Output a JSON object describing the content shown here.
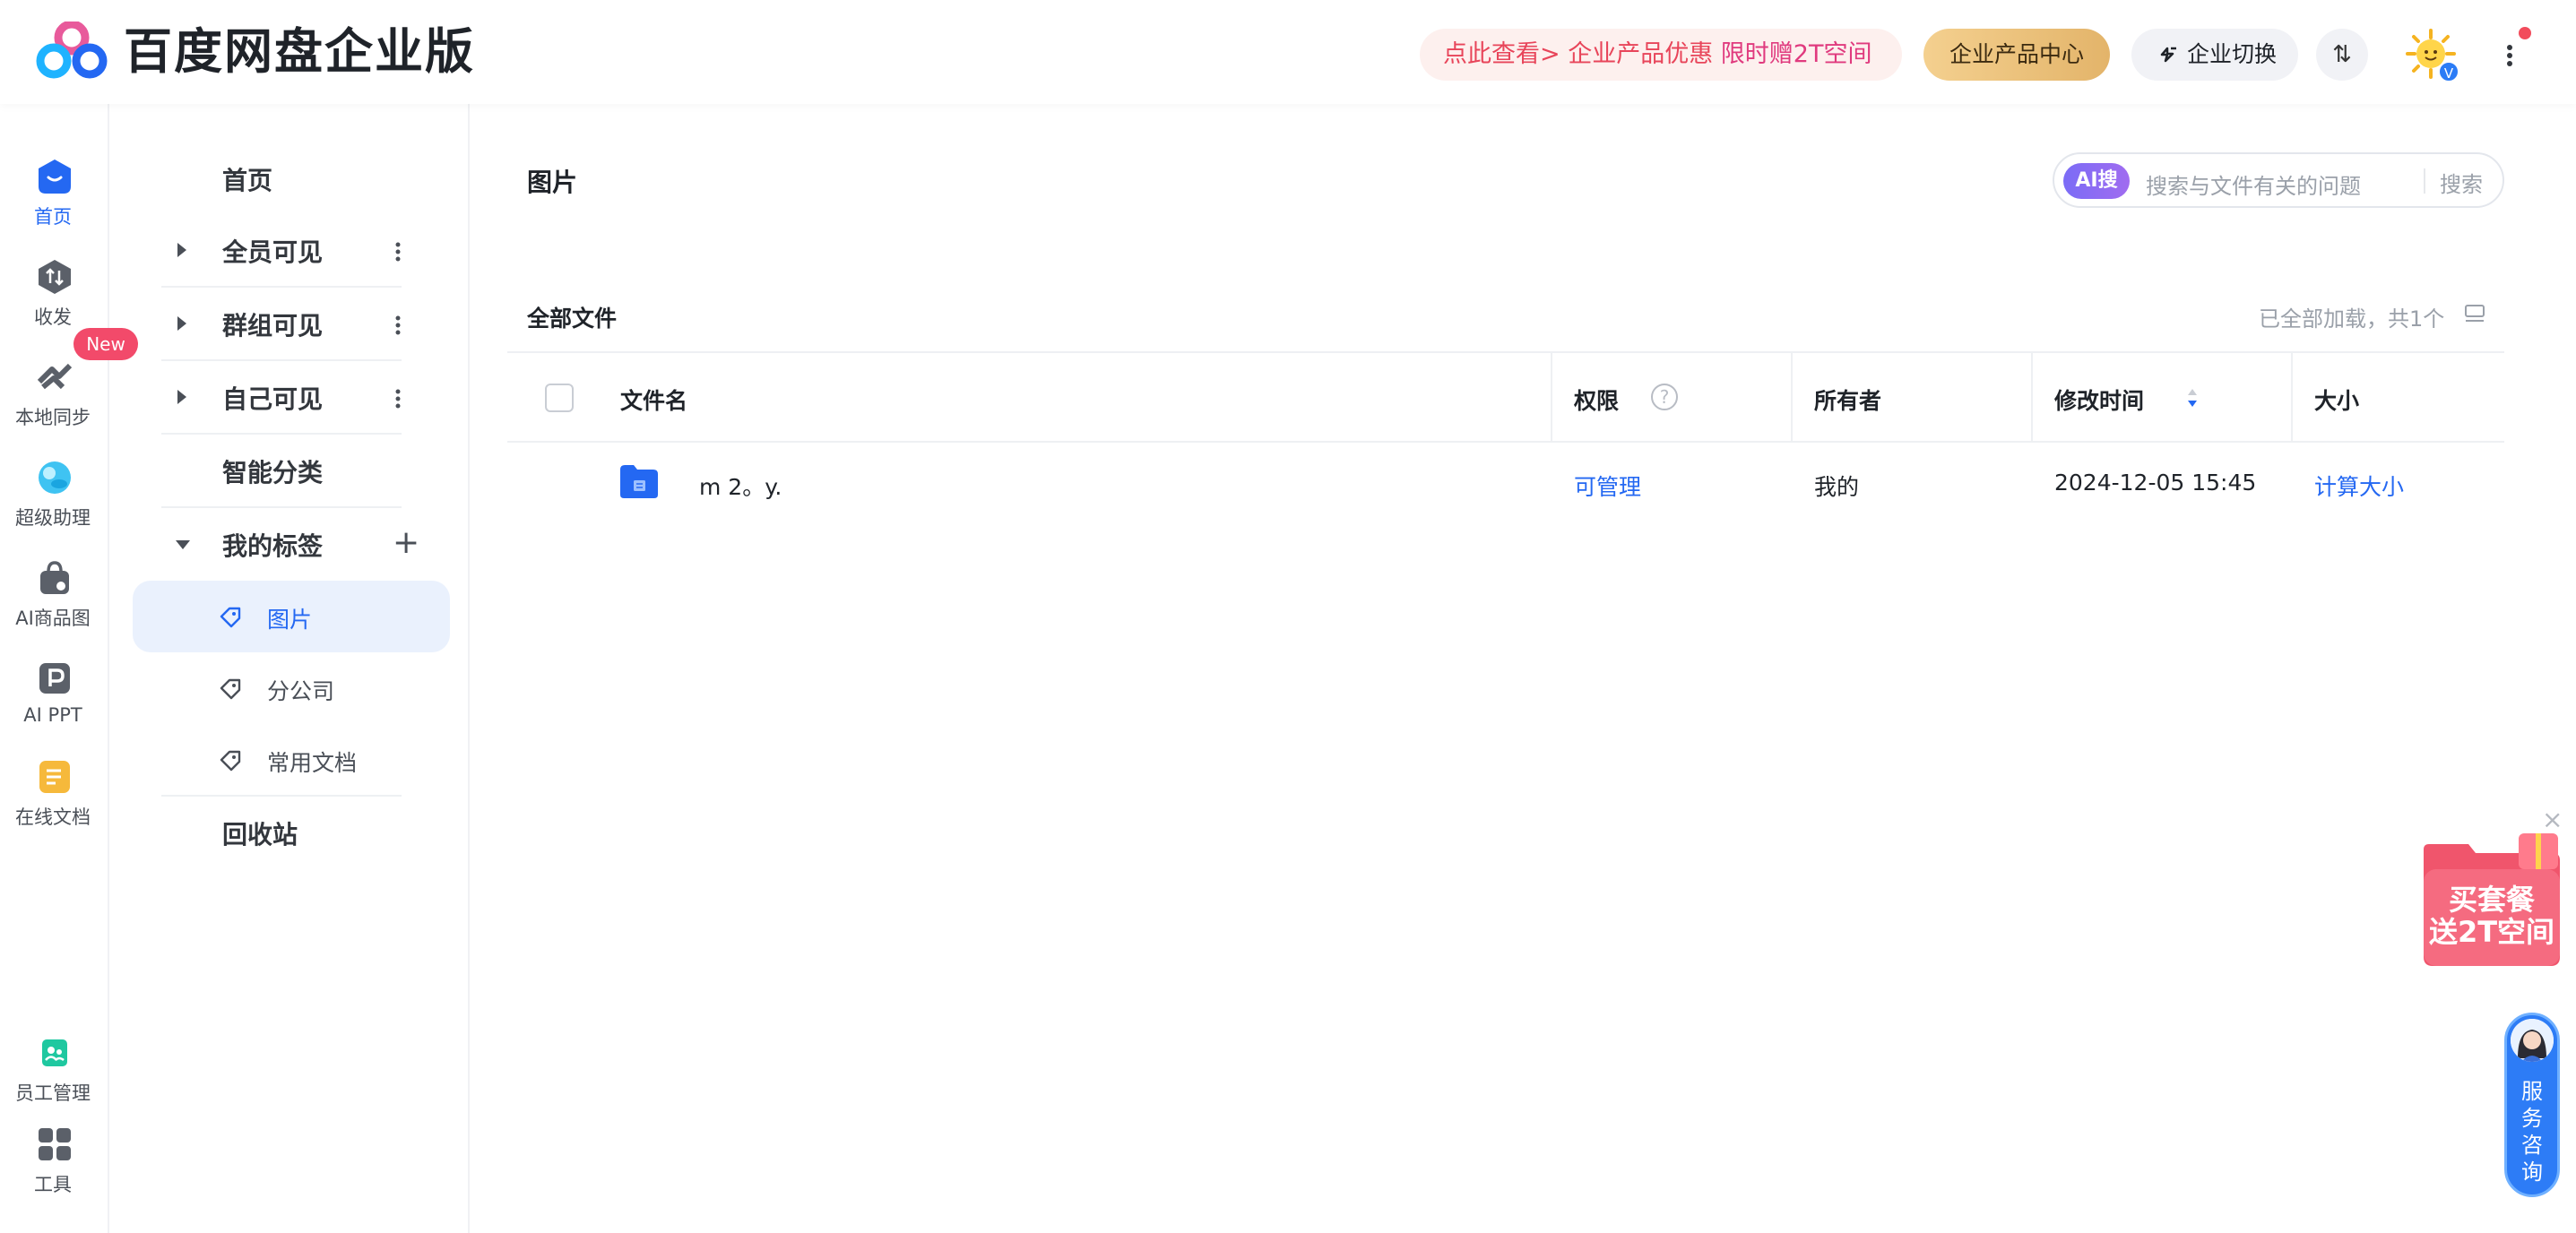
{
  "app": {
    "brand": "百度网盘企业版"
  },
  "header": {
    "promo_prefix": "点此查看> 企业产品优惠 ",
    "promo_highlight": "限时赠2T空间",
    "product_center": "企业产品中心",
    "switch_enterprise": "企业切换",
    "transfer_glyph": "⇅",
    "avatar_badge": "V"
  },
  "rail": {
    "items": [
      {
        "label": "首页",
        "icon": "home-icon",
        "active": true
      },
      {
        "label": "收发",
        "icon": "transfer-icon"
      },
      {
        "label": "本地同步",
        "icon": "sync-icon"
      },
      {
        "label": "超级助理",
        "icon": "assistant-icon"
      },
      {
        "label": "AI商品图",
        "icon": "shopping-bag-icon"
      },
      {
        "label": "AI PPT",
        "icon": "ppt-icon"
      },
      {
        "label": "在线文档",
        "icon": "document-icon"
      },
      {
        "label": "员工管理",
        "icon": "staff-icon"
      },
      {
        "label": "工具",
        "icon": "tools-icon"
      }
    ],
    "new_badge": "New"
  },
  "tree": {
    "home": "首页",
    "all_visible": "全员可见",
    "group_visible": "群组可见",
    "self_visible": "自己可见",
    "smart_category": "智能分类",
    "my_tags": "我的标签",
    "tags": [
      {
        "label": "图片",
        "active": true
      },
      {
        "label": "分公司"
      },
      {
        "label": "常用文档"
      }
    ],
    "recycle": "回收站"
  },
  "main": {
    "title": "图片",
    "search": {
      "ai_label": "AI搜",
      "placeholder": "搜索与文件有关的问题",
      "button": "搜索"
    },
    "section_title": "全部文件",
    "loaded_status": "已全部加载，共1个",
    "columns": {
      "name": "文件名",
      "permission": "权限",
      "owner": "所有者",
      "modified": "修改时间",
      "size": "大小"
    },
    "rows": [
      {
        "name": "m 2。y.",
        "permission": "可管理",
        "owner": "我的",
        "modified": "2024-12-05 15:45",
        "size": "计算大小",
        "icon": "folder-icon"
      }
    ]
  },
  "float": {
    "promo_line1": "买套餐",
    "promo_line2": "送2T空间",
    "close": "×",
    "service_line1": "服",
    "service_line2": "务",
    "service_line3": "咨",
    "service_line4": "询"
  },
  "colors": {
    "accent": "#2468f2",
    "promo_text": "#e8455a",
    "gold": "#e3b46a",
    "badge_red": "#f24a6a"
  }
}
